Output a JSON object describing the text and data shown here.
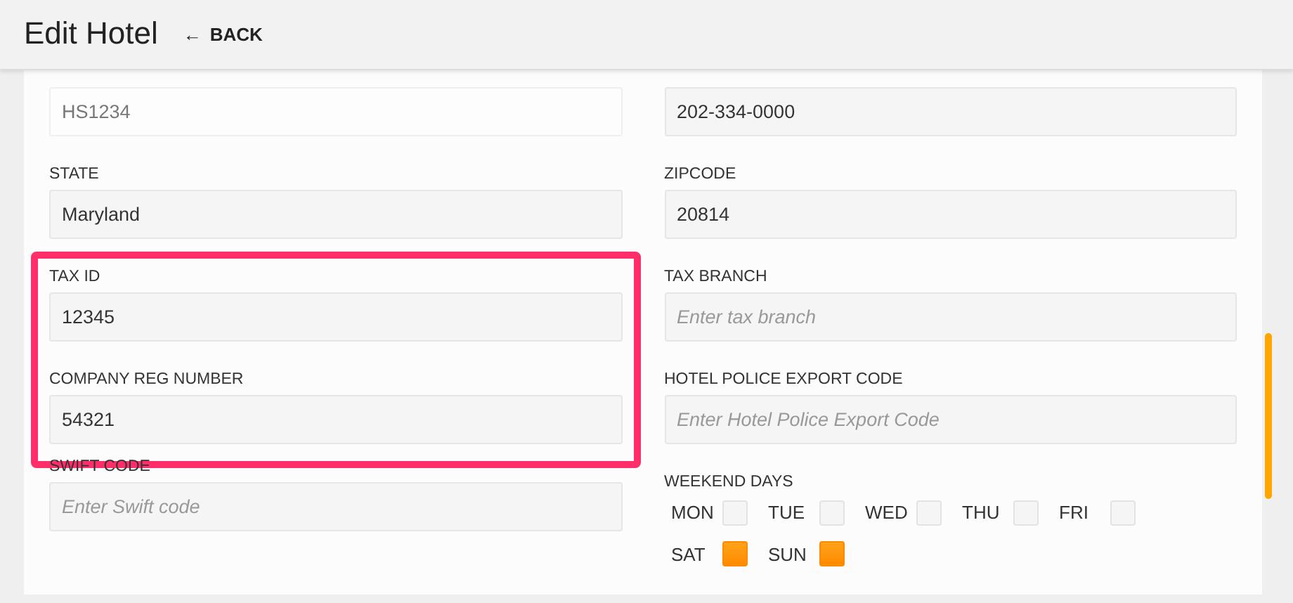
{
  "header": {
    "title": "Edit Hotel",
    "back_link": {
      "arrow": "←",
      "label": "BACK"
    }
  },
  "left_fields": [
    {
      "value": "HS1234",
      "disabled": true,
      "highlighted": false
    },
    {
      "label": "STATE",
      "value": "Maryland",
      "disabled": false,
      "highlighted": false
    },
    {
      "label": "TAX ID",
      "value": "12345",
      "disabled": false,
      "highlighted": true
    },
    {
      "label": "COMPANY REG NUMBER",
      "value": "54321",
      "disabled": false,
      "highlighted": true
    },
    {
      "label": "SWIFT CODE",
      "placeholder": "Enter Swift code",
      "disabled": false,
      "highlighted": false
    }
  ],
  "right_fields": [
    {
      "value": "202-334-0000",
      "disabled": false
    },
    {
      "label": "ZIPCODE",
      "value": "20814",
      "disabled": false
    },
    {
      "label": "TAX BRANCH",
      "placeholder": "Enter tax branch",
      "disabled": false
    },
    {
      "label": "HOTEL POLICE EXPORT CODE",
      "placeholder": "Enter Hotel Police Export Code",
      "disabled": false
    }
  ],
  "weekend_days": {
    "label": "WEEKEND DAYS",
    "days": [
      {
        "label": "MON",
        "checked": false
      },
      {
        "label": "TUE",
        "checked": false
      },
      {
        "label": "WED",
        "checked": false
      },
      {
        "label": "THU",
        "checked": false
      },
      {
        "label": "FRI",
        "checked": false
      },
      {
        "label": "SAT",
        "checked": true
      },
      {
        "label": "SUN",
        "checked": true
      }
    ]
  }
}
